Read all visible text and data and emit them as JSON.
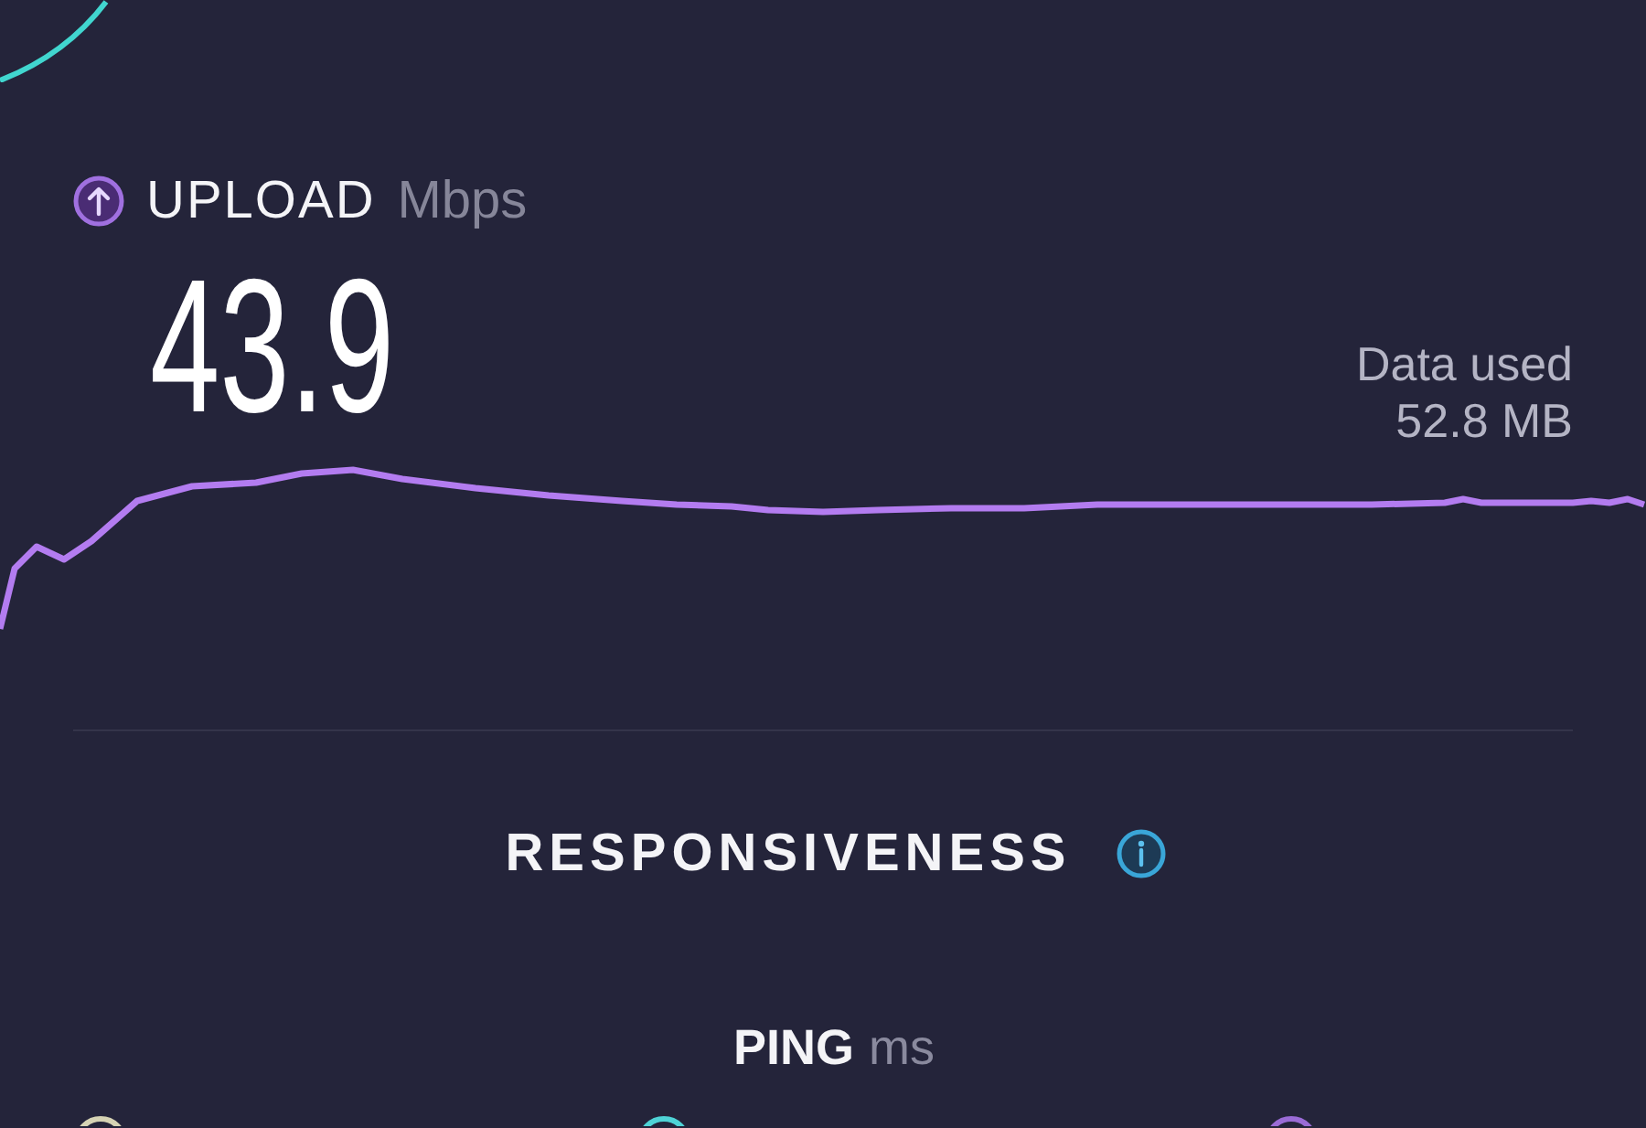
{
  "upload": {
    "label": "UPLOAD",
    "unit": "Mbps",
    "value": "43.9"
  },
  "data_used": {
    "label": "Data used",
    "value": "52.8 MB"
  },
  "responsiveness": {
    "title": "RESPONSIVENESS"
  },
  "ping": {
    "label": "PING",
    "unit": "ms"
  },
  "latency_icons": [
    {
      "color": "#d6d3b4"
    },
    {
      "color": "#4fd3d6"
    },
    {
      "color": "#9a6bd6"
    }
  ]
}
